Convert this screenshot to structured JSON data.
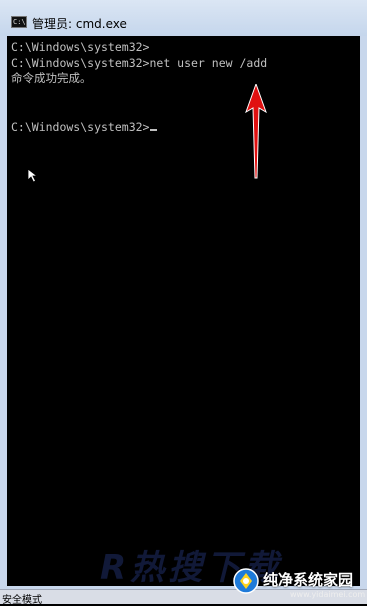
{
  "window": {
    "title": "管理员: cmd.exe",
    "icon": "cmd-icon",
    "icon_text": "C:\\"
  },
  "console": {
    "lines": [
      "C:\\Windows\\system32>",
      "C:\\Windows\\system32>net user new /add",
      "命令成功完成。",
      "",
      "C:\\Windows\\system32>"
    ],
    "text_color": "#c0c0c0",
    "background": "#000000"
  },
  "annotation": {
    "arrow_color": "#e01010"
  },
  "statusbar": {
    "text": "安全模式"
  },
  "watermark": {
    "large_text": "R热搜下载",
    "brand": "纯净系统家园",
    "url": "www.yidaimei.com"
  }
}
